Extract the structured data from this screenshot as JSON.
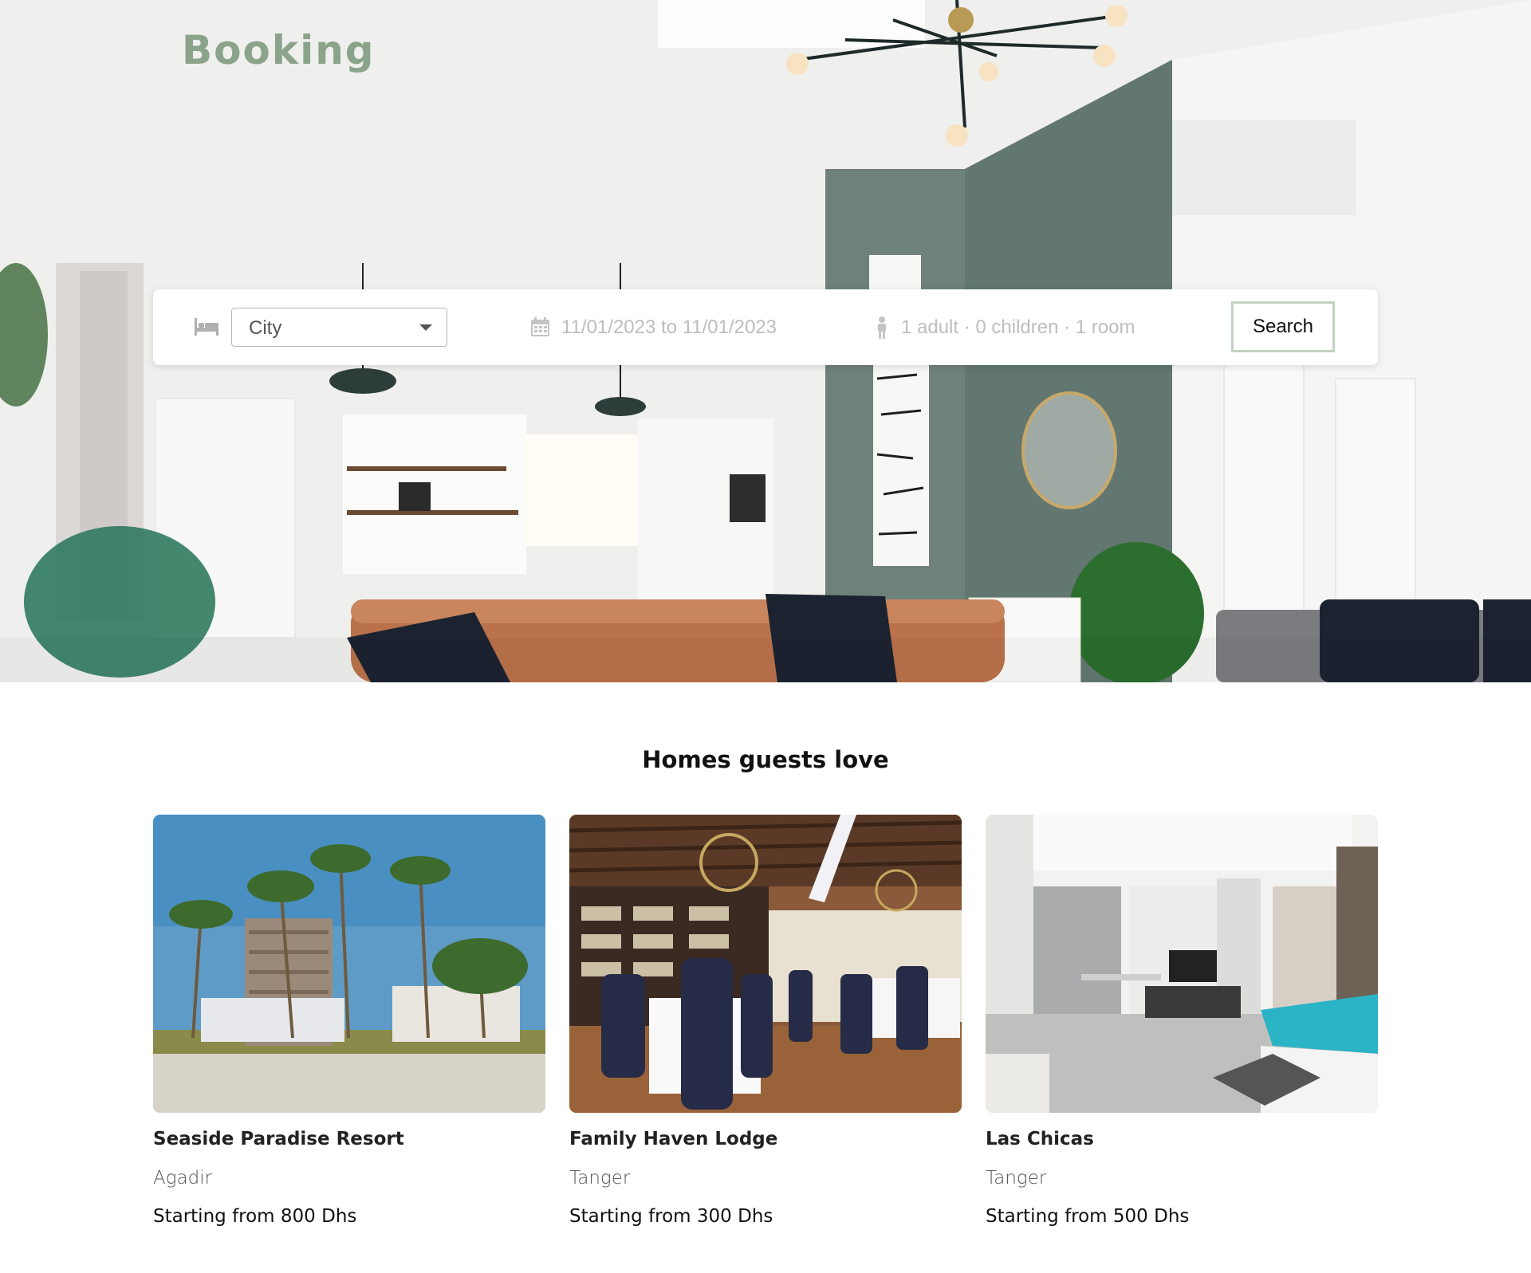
{
  "brand": {
    "logo": "Booking"
  },
  "search": {
    "city_placeholder": "City",
    "dates": "11/01/2023 to 11/01/2023",
    "guests": "1 adult · 0 children · 1 room",
    "button_label": "Search",
    "icons": {
      "bed": "bed-icon",
      "calendar": "calendar-icon",
      "person": "person-icon"
    }
  },
  "section": {
    "title": "Homes guests love"
  },
  "listings": [
    {
      "name": "Seaside Paradise Resort",
      "city": "Agadir",
      "price": "Starting from 800 Dhs"
    },
    {
      "name": "Family Haven Lodge",
      "city": "Tanger",
      "price": "Starting from 300 Dhs"
    },
    {
      "name": "Las Chicas",
      "city": "Tanger",
      "price": "Starting from 500 Dhs"
    }
  ],
  "colors": {
    "brand": "#8aa38a",
    "search_border": "#c3d3c2",
    "accent_wall": "#6e817b"
  }
}
